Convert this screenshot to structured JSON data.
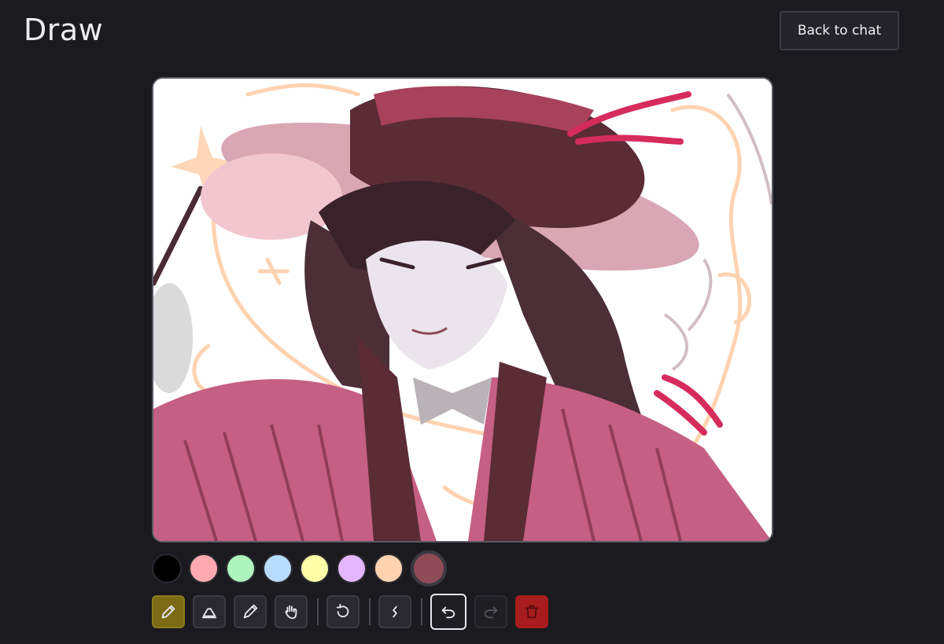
{
  "header": {
    "title": "Draw",
    "back_label": "Back to chat"
  },
  "canvas": {
    "description_icon": "drawing-canvas"
  },
  "palette": {
    "colors": [
      "#000000",
      "#ffaab1",
      "#aef5bd",
      "#b7dcff",
      "#ffffa8",
      "#e3b6ff",
      "#ffd2b0",
      "#8f4b58"
    ],
    "selected_index": 7
  },
  "tools": [
    {
      "name": "pencil-icon",
      "active": true
    },
    {
      "name": "eraser-icon",
      "active": false
    },
    {
      "name": "eyedropper-icon",
      "active": false
    },
    {
      "name": "hand-icon",
      "active": false
    },
    {
      "name": "reset-icon",
      "active": false
    },
    {
      "name": "stroke-style-icon",
      "active": false
    },
    {
      "name": "undo-icon",
      "active": false
    },
    {
      "name": "redo-icon",
      "active": false,
      "disabled": true
    },
    {
      "name": "trash-icon",
      "active": false
    }
  ],
  "colors": {
    "background": "#1b1a1f",
    "active_tool": "#7a6b14",
    "delete": "#a71d1d"
  }
}
